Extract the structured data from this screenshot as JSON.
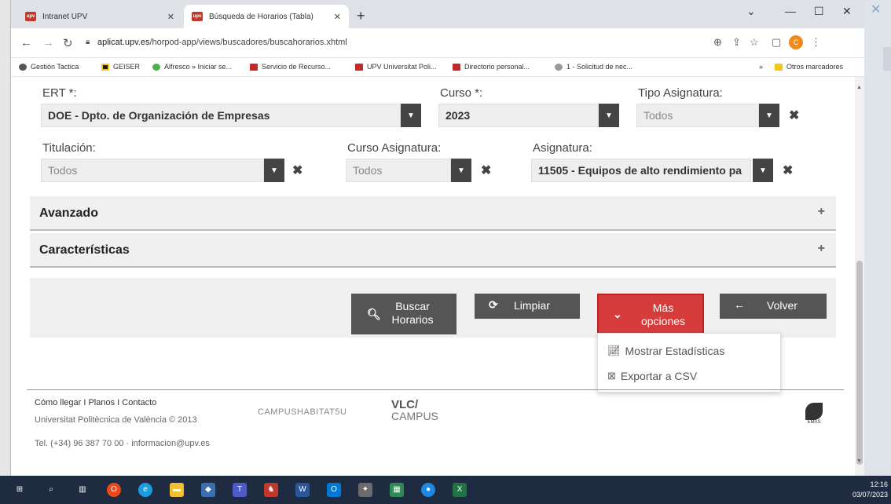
{
  "browser": {
    "tabs": [
      {
        "title": "Intranet UPV",
        "favicon": "upv-favicon"
      },
      {
        "title": "Búsqueda de Horarios (Tabla)",
        "favicon": "upv-favicon"
      }
    ],
    "url_host": "aplicat.upv.es",
    "url_path": "/horpod-app/views/buscadores/buscahorarios.xhtml",
    "profile_initial": "C",
    "bookmarks": [
      {
        "label": "Gestión Tactica",
        "color": "#555555"
      },
      {
        "label": "GEISER",
        "color": "#1a1a1a"
      },
      {
        "label": "Alfresco » Iniciar se...",
        "color": "#4caf50"
      },
      {
        "label": "Servicio de Recurso...",
        "color": "#c62828"
      },
      {
        "label": "UPV Universitat Poli...",
        "color": "#c62828"
      },
      {
        "label": "Directorio personal...",
        "color": "#c62828"
      },
      {
        "label": "1 - Solicitud de nec...",
        "color": "#999999"
      }
    ],
    "bookmarks_more": "»",
    "other_bookmarks": "Otros marcadores"
  },
  "form": {
    "ert_label": "ERT *:",
    "ert_value": "DOE - Dpto. de Organización de Empresas",
    "curso_label": "Curso *:",
    "curso_value": "2023",
    "tipo_label": "Tipo Asignatura:",
    "tipo_value": "Todos",
    "titulacion_label": "Titulación:",
    "titulacion_value": "Todos",
    "curso_asig_label": "Curso Asignatura:",
    "curso_asig_value": "Todos",
    "asignatura_label": "Asignatura:",
    "asignatura_value": "11505 - Equipos de alto rendimiento pa"
  },
  "panels": {
    "avanzado": "Avanzado",
    "caracteristicas": "Características"
  },
  "buttons": {
    "buscar": "Buscar Horarios",
    "limpiar": "Limpiar",
    "mas": "Más opciones",
    "volver": "Volver"
  },
  "dropdown": {
    "estadisticas": "Mostrar Estadísticas",
    "csv": "Exportar a CSV"
  },
  "footer": {
    "links": "Cómo llegar I Planos I Contacto",
    "university": "Universitat Politècnica de València © 2013",
    "contact": "Tel. (+34) 96 387 70 00 · informacion@upv.es",
    "campus_logo": "CAMPUSHABITAT5U",
    "vlc": "VLC/",
    "vlc_sub": "CAMPUS",
    "emas": "EMAS"
  },
  "taskbar": {
    "time": "12:16",
    "date": "03/07/2023"
  },
  "colors": {
    "accent_red": "#d63c3c",
    "dark_button": "#555555",
    "taskbar": "#1f2b40"
  }
}
